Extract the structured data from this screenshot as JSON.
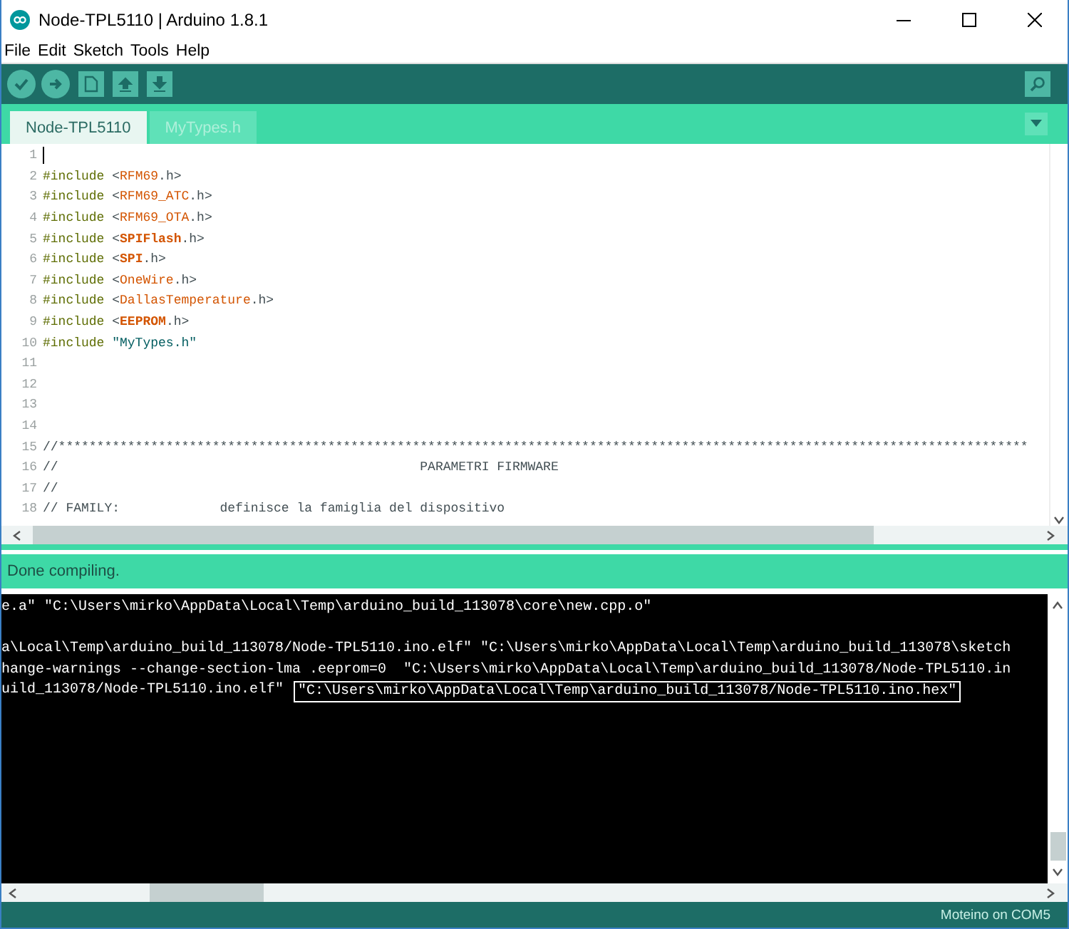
{
  "window": {
    "title": "Node-TPL5110 | Arduino 1.8.1"
  },
  "menu": [
    {
      "label": "File"
    },
    {
      "label": "Edit"
    },
    {
      "label": "Sketch"
    },
    {
      "label": "Tools"
    },
    {
      "label": "Help"
    }
  ],
  "tabs": [
    {
      "label": "Node-TPL5110",
      "selected": true
    },
    {
      "label": "MyTypes.h",
      "selected": false
    }
  ],
  "editor": {
    "lines": [
      {
        "number": "1"
      },
      {
        "number": "2",
        "tokens": [
          {
            "kind": "directive",
            "text": "#include"
          },
          {
            "kind": "plain",
            "text": " <"
          },
          {
            "kind": "library",
            "text": "RFM69"
          },
          {
            "kind": "plain",
            "text": ".h>"
          }
        ]
      },
      {
        "number": "3",
        "tokens": [
          {
            "kind": "directive",
            "text": "#include"
          },
          {
            "kind": "plain",
            "text": " <"
          },
          {
            "kind": "library",
            "text": "RFM69_ATC"
          },
          {
            "kind": "plain",
            "text": ".h>"
          }
        ]
      },
      {
        "number": "4",
        "tokens": [
          {
            "kind": "directive",
            "text": "#include"
          },
          {
            "kind": "plain",
            "text": " <"
          },
          {
            "kind": "library",
            "text": "RFM69_OTA"
          },
          {
            "kind": "plain",
            "text": ".h>"
          }
        ]
      },
      {
        "number": "5",
        "tokens": [
          {
            "kind": "directive",
            "text": "#include"
          },
          {
            "kind": "plain",
            "text": " <"
          },
          {
            "kind": "keyword",
            "text": "SPIFlash"
          },
          {
            "kind": "plain",
            "text": ".h>"
          }
        ]
      },
      {
        "number": "6",
        "tokens": [
          {
            "kind": "directive",
            "text": "#include"
          },
          {
            "kind": "plain",
            "text": " <"
          },
          {
            "kind": "keyword",
            "text": "SPI"
          },
          {
            "kind": "plain",
            "text": ".h>"
          }
        ]
      },
      {
        "number": "7",
        "tokens": [
          {
            "kind": "directive",
            "text": "#include"
          },
          {
            "kind": "plain",
            "text": " <"
          },
          {
            "kind": "library",
            "text": "OneWire"
          },
          {
            "kind": "plain",
            "text": ".h>"
          }
        ]
      },
      {
        "number": "8",
        "tokens": [
          {
            "kind": "directive",
            "text": "#include"
          },
          {
            "kind": "plain",
            "text": " <"
          },
          {
            "kind": "library",
            "text": "DallasTemperature"
          },
          {
            "kind": "plain",
            "text": ".h>"
          }
        ]
      },
      {
        "number": "9",
        "tokens": [
          {
            "kind": "directive",
            "text": "#include"
          },
          {
            "kind": "plain",
            "text": " <"
          },
          {
            "kind": "keyword",
            "text": "EEPROM"
          },
          {
            "kind": "plain",
            "text": ".h>"
          }
        ]
      },
      {
        "number": "10",
        "tokens": [
          {
            "kind": "directive",
            "text": "#include"
          },
          {
            "kind": "string",
            "text": "\"MyTypes.h\""
          }
        ]
      },
      {
        "number": "11"
      },
      {
        "number": "12"
      },
      {
        "number": "13"
      },
      {
        "number": "14"
      },
      {
        "number": "15",
        "tokens": [
          {
            "kind": "comment",
            "text": "//******************************************************************************************************************************"
          }
        ]
      },
      {
        "number": "16",
        "tokens": [
          {
            "kind": "comment",
            "text": "//                                               PARAMETRI FIRMWARE"
          }
        ]
      },
      {
        "number": "17",
        "tokens": [
          {
            "kind": "comment",
            "text": "//"
          }
        ]
      },
      {
        "number": "18",
        "tokens": [
          {
            "kind": "comment",
            "text": "// FAMILY:             definisce la famiglia del dispositivo"
          }
        ]
      }
    ]
  },
  "status_message": "Done compiling.",
  "console": {
    "lines": [
      {
        "parts": [
          {
            "text": "e.a\" \"C:\\Users\\mirko\\AppData\\Local\\Temp\\arduino_build_113078\\core\\new.cpp.o\"",
            "boxed": false
          }
        ]
      },
      {
        "kind": "blank"
      },
      {
        "parts": [
          {
            "text": "a\\Local\\Temp\\arduino_build_113078/Node-TPL5110.ino.elf\" \"C:\\Users\\mirko\\AppData\\Local\\Temp\\arduino_build_113078\\sketch",
            "boxed": false
          }
        ]
      },
      {
        "parts": [
          {
            "text": "hange-warnings --change-section-lma .eeprom=0  \"C:\\Users\\mirko\\AppData\\Local\\Temp\\arduino_build_113078/Node-TPL5110.in",
            "boxed": false
          }
        ]
      },
      {
        "parts": [
          {
            "text": "uild_113078/Node-TPL5110.ino.elf\" ",
            "boxed": false
          },
          {
            "text": "\"C:\\Users\\mirko\\AppData\\Local\\Temp\\arduino_build_113078/Node-TPL5110.ino.hex\"",
            "boxed": true
          }
        ]
      }
    ]
  },
  "board_status": "Moteino on COM5"
}
